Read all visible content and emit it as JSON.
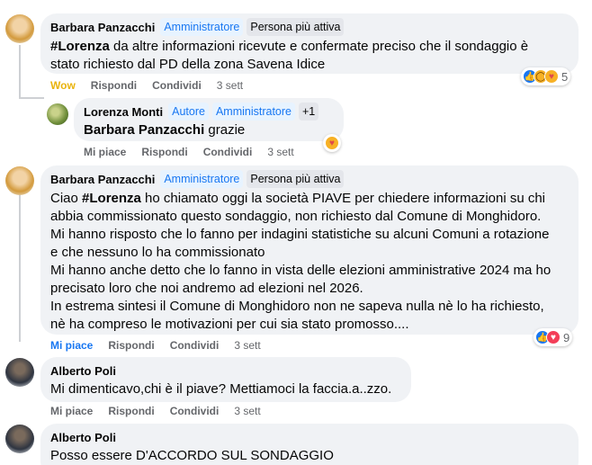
{
  "comments": [
    {
      "author": "Barbara Panzacchi",
      "badges": [
        "Amministratore",
        "Persona più attiva"
      ],
      "mention": "#Lorenza",
      "text_lines": [
        " da altre informazioni ricevute e confermate preciso che il sondaggio è",
        "stato richiesto dal PD della zona Savena Idice"
      ],
      "actions": {
        "reaction": "Wow",
        "reply": "Rispondi",
        "share": "Condividi",
        "time": "3 sett"
      },
      "reaction_count": "5"
    },
    {
      "author": "Lorenza Monti",
      "badges": [
        "Autore",
        "Amministratore",
        "+1"
      ],
      "mention": "Barbara Panzacchi",
      "text_lines": [
        " grazie"
      ],
      "actions": {
        "reaction": "Mi piace",
        "reply": "Rispondi",
        "share": "Condividi",
        "time": "3 sett"
      }
    },
    {
      "author": "Barbara Panzacchi",
      "badges": [
        "Amministratore",
        "Persona più attiva"
      ],
      "first_line_prefix": "Ciao ",
      "mention": "#Lorenza",
      "text_lines": [
        " ho chiamato oggi la società PIAVE per chiedere informazioni su chi",
        "abbia commissionato questo sondaggio, non richiesto dal Comune di Monghidoro.",
        "Mi hanno risposto che lo fanno per indagini statistiche su alcuni Comuni a rotazione",
        "e che nessuno lo ha commissionato",
        "Mi hanno anche detto che lo fanno in vista delle elezioni amministrative 2024 ma ho",
        "precisato loro che noi andremo ad elezioni nel 2026.",
        "In estrema sintesi il Comune di Monghidoro non ne sapeva nulla nè lo ha richiesto,",
        "nè ha compreso le motivazioni per cui sia stato promosso...."
      ],
      "actions": {
        "reaction": "Mi piace",
        "reply": "Rispondi",
        "share": "Condividi",
        "time": "3 sett"
      },
      "reaction_count": "9"
    },
    {
      "author": "Alberto Poli",
      "text_lines": [
        "Mi dimenticavo,chi è il piave? Mettiamoci la faccia.a..zzo."
      ],
      "actions": {
        "reaction": "Mi piace",
        "reply": "Rispondi",
        "share": "Condividi",
        "time": "3 sett"
      }
    },
    {
      "author": "Alberto Poli",
      "text_lines": [
        "Posso essere D'ACCORDO SUL SONDAGGIO"
      ]
    }
  ],
  "colors": {
    "wow": "#e9b30c",
    "like_blue": "#1877f2",
    "love_red": "#f33e58",
    "meta_gray": "#65676b"
  },
  "icons": {
    "like": "like-icon",
    "wow": "wow-icon",
    "care": "care-icon",
    "love": "love-icon"
  }
}
